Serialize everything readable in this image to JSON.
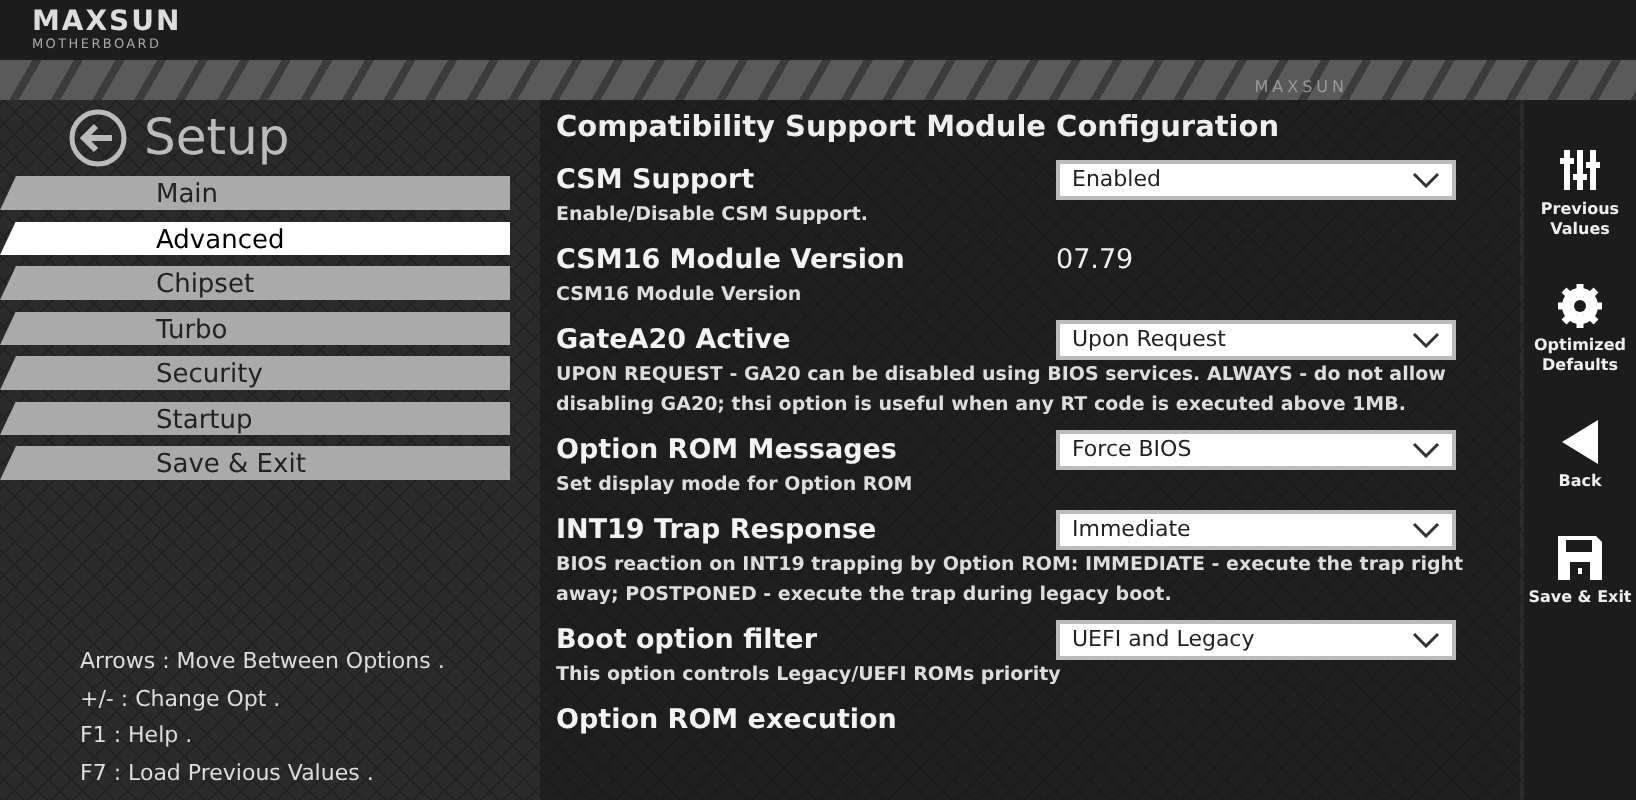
{
  "brand": {
    "name": "MAXSUN",
    "tagline": "MOTHERBOARD",
    "banner": "MAXSUN"
  },
  "title": "Setup",
  "menu": [
    {
      "label": "Main",
      "selected": false
    },
    {
      "label": "Advanced",
      "selected": true
    },
    {
      "label": "Chipset",
      "selected": false
    },
    {
      "label": "Turbo",
      "selected": false
    },
    {
      "label": "Security",
      "selected": false
    },
    {
      "label": "Startup",
      "selected": false
    },
    {
      "label": "Save & Exit",
      "selected": false
    }
  ],
  "help": [
    "Arrows : Move Between Options .",
    "+/- : Change Opt .",
    "F1 : Help .",
    "F7 : Load Previous Values ."
  ],
  "section_title": "Compatibility Support Module Configuration",
  "settings": [
    {
      "label": "CSM Support",
      "kind": "select",
      "value": "Enabled",
      "description": "Enable/Disable CSM Support."
    },
    {
      "label": "CSM16 Module Version",
      "kind": "value",
      "value": "07.79",
      "description": "CSM16 Module Version"
    },
    {
      "label": "GateA20 Active",
      "kind": "select",
      "value": "Upon Request",
      "description": "UPON REQUEST - GA20 can be disabled using BIOS services. ALWAYS - do not allow disabling GA20; thsi option is useful when any RT code is executed above 1MB."
    },
    {
      "label": "Option ROM Messages",
      "kind": "select",
      "value": "Force BIOS",
      "description": "Set display mode for Option ROM"
    },
    {
      "label": "INT19 Trap Response",
      "kind": "select",
      "value": "Immediate",
      "description": "BIOS reaction on INT19 trapping by Option ROM: IMMEDIATE - execute the trap right away; POSTPONED - execute the trap during legacy boot."
    },
    {
      "label": "Boot option filter",
      "kind": "select",
      "value": "UEFI and Legacy",
      "description": "This option controls Legacy/UEFI ROMs priority"
    },
    {
      "label": "Option ROM execution",
      "kind": "heading"
    }
  ],
  "actions": [
    {
      "kind": "sliders",
      "label": "Previous Values"
    },
    {
      "kind": "gear",
      "label": "Optimized Defaults"
    },
    {
      "kind": "back",
      "label": "Back"
    },
    {
      "kind": "save",
      "label": "Save & Exit"
    }
  ]
}
